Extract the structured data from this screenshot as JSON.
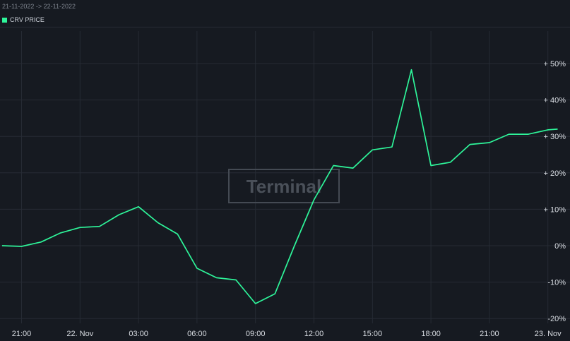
{
  "header": {
    "date_range": "21-11-2022 -> 22-11-2022"
  },
  "watermark": {
    "text": "Terminal"
  },
  "colors": {
    "line": "#2ef59a",
    "background": "#161a21",
    "grid": "#262b34"
  },
  "chart_data": {
    "type": "line",
    "title": "",
    "xlabel": "",
    "ylabel": "",
    "ylim": [
      -20,
      60
    ],
    "y_ticks": [
      50,
      40,
      30,
      20,
      10,
      0,
      -10,
      -20
    ],
    "y_tick_labels": [
      "+ 50%",
      "+ 40%",
      "+ 30%",
      "+ 20%",
      "+ 10%",
      "0%",
      "-10%",
      "-20%"
    ],
    "x_tick_labels": [
      {
        "hour": 0,
        "label": "21:00"
      },
      {
        "hour": 3,
        "label": "22. Nov"
      },
      {
        "hour": 6,
        "label": "03:00"
      },
      {
        "hour": 9,
        "label": "06:00"
      },
      {
        "hour": 12,
        "label": "09:00"
      },
      {
        "hour": 15,
        "label": "12:00"
      },
      {
        "hour": 18,
        "label": "15:00"
      },
      {
        "hour": 21,
        "label": "18:00"
      },
      {
        "hour": 24,
        "label": "21:00"
      },
      {
        "hour": 27,
        "label": "23. Nov"
      }
    ],
    "grid": true,
    "series": [
      {
        "name": "CRV PRICE",
        "x": [
          -1,
          0,
          1,
          2,
          3,
          4,
          5,
          6,
          7,
          8,
          9,
          10,
          11,
          12,
          13,
          14,
          15,
          16,
          17,
          18,
          19,
          20,
          21,
          22,
          23,
          24,
          25,
          26,
          27,
          27.5
        ],
        "values": [
          0,
          -0.2,
          1,
          3.5,
          5,
          5.3,
          8.5,
          10.7,
          6.3,
          3.2,
          -6.2,
          -8.8,
          -9.4,
          -15.9,
          -13.2,
          0,
          12.6,
          22,
          21.3,
          26.3,
          27.1,
          48.3,
          22,
          22.9,
          27.8,
          28.3,
          30.6,
          30.6,
          31.8,
          32
        ]
      }
    ]
  }
}
